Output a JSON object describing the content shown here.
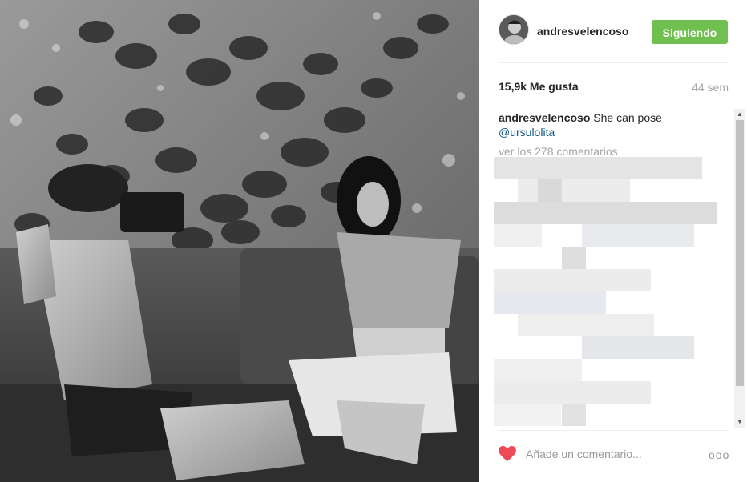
{
  "post": {
    "username": "andresvelencoso",
    "follow_label": "Siguiendo",
    "likes": "15,9k Me gusta",
    "age": "44 sem",
    "caption_user": "andresvelencoso",
    "caption_text": " She can pose",
    "caption_mention": "@ursulolita",
    "view_comments": "ver los 278 comentarios",
    "comment_placeholder": "Añade un comentario...",
    "more_label": "ooo"
  },
  "icons": {
    "like": "heart-icon",
    "more": "more-options-icon",
    "scroll_up": "scroll-up-arrow-icon",
    "scroll_down": "scroll-down-arrow-icon"
  },
  "colors": {
    "follow_button": "#70c050",
    "heart": "#ed4956",
    "mention": "#125688",
    "muted_text": "#a5a5a5"
  }
}
